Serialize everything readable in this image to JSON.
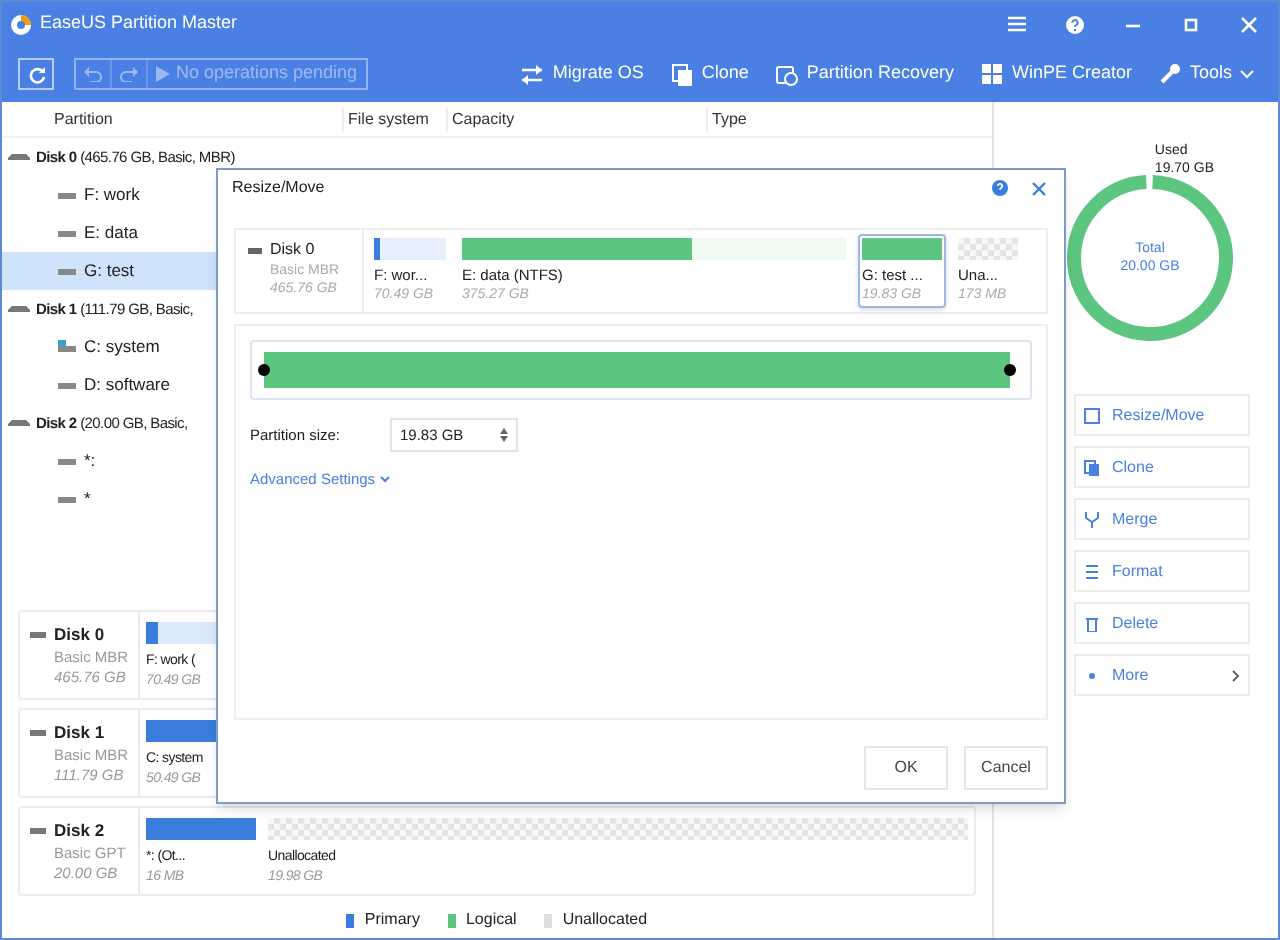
{
  "window": {
    "title": "EaseUS Partition Master"
  },
  "toolbar": {
    "undo_disabled": true,
    "redo_disabled": true,
    "status": "No operations pending",
    "status_disabled": true
  },
  "tools": [
    {
      "kind": "migrate",
      "label": "Migrate OS"
    },
    {
      "kind": "clone",
      "label": "Clone"
    },
    {
      "kind": "recovery",
      "label": "Partition Recovery"
    },
    {
      "kind": "winpe",
      "label": "WinPE Creator"
    },
    {
      "kind": "tools",
      "label": "Tools"
    }
  ],
  "table": {
    "columns": [
      "Partition",
      "File system",
      "Capacity",
      "Type"
    ],
    "disks": [
      {
        "name": "Disk 0",
        "detail": "(465.76 GB, Basic, MBR)",
        "children": [
          {
            "kind": "drive",
            "name": "F: work",
            "selected": false
          },
          {
            "kind": "drive",
            "name": "E: data",
            "selected": false
          },
          {
            "kind": "drive",
            "name": "G: test",
            "selected": true
          }
        ]
      },
      {
        "name": "Disk 1",
        "detail": "(111.79 GB, Basic,",
        "children": [
          {
            "kind": "system",
            "name": "C: system",
            "selected": false
          },
          {
            "kind": "drive",
            "name": "D: software",
            "selected": false
          }
        ]
      },
      {
        "name": "Disk 2",
        "detail": "(20.00 GB, Basic,",
        "children": [
          {
            "kind": "drive",
            "name": "*:",
            "selected": false
          },
          {
            "kind": "drive",
            "name": "*",
            "selected": false
          }
        ]
      }
    ]
  },
  "disk_map": [
    {
      "name": "Disk 0",
      "type": "Basic MBR",
      "size": "465.76 GB",
      "partitions": [
        {
          "kind": "primary",
          "label": "F: work (",
          "size": "70.49 GB",
          "level": 0.1
        }
      ]
    },
    {
      "name": "Disk 1",
      "type": "Basic MBR",
      "size": "111.79 GB",
      "partitions": [
        {
          "kind": "primary",
          "label": "C: system",
          "size": "50.49 GB",
          "level": 1
        }
      ]
    },
    {
      "name": "Disk 2",
      "type": "Basic GPT",
      "size": "20.00 GB",
      "partitions": [
        {
          "kind": "primary",
          "label": "*: (Ot...",
          "size": "16 MB",
          "level": 1
        },
        {
          "kind": "unallocated",
          "label": "Unallocated",
          "size": "19.98 GB"
        }
      ]
    }
  ],
  "legend": [
    {
      "label": "Primary",
      "color": "#3b7ddd"
    },
    {
      "label": "Logical",
      "color": "#5cc57f"
    },
    {
      "label": "Unallocated",
      "color": "#dddddd"
    }
  ],
  "usage": {
    "used_label": "Used",
    "used": "19.70 GB",
    "total_label": "Total",
    "total": "20.00 GB",
    "level": 0.985
  },
  "actions": [
    {
      "kind": "resize",
      "label": "Resize/Move"
    },
    {
      "kind": "clone",
      "label": "Clone"
    },
    {
      "kind": "merge",
      "label": "Merge"
    },
    {
      "kind": "format",
      "label": "Format"
    },
    {
      "kind": "delete",
      "label": "Delete"
    },
    {
      "kind": "more",
      "label": "More"
    }
  ],
  "dialog": {
    "title": "Resize/Move",
    "disk": {
      "name": "Disk 0",
      "type": "Basic MBR",
      "size": "465.76 GB"
    },
    "partitions": [
      {
        "kind": "primary",
        "label": "F: wor...",
        "size": "70.49 GB",
        "level": 0.08,
        "selected": false
      },
      {
        "kind": "logical",
        "label": "E: data (NTFS)",
        "size": "375.27 GB",
        "level": 0.6,
        "selected": false
      },
      {
        "kind": "logical",
        "label": "G: test ...",
        "size": "19.83 GB",
        "level": 1,
        "selected": true
      },
      {
        "kind": "unallocated",
        "label": "Una...",
        "size": "173 MB",
        "selected": false
      }
    ],
    "resize": {
      "level": 0.99
    },
    "size_label": "Partition size:",
    "size_value": "19.83 GB",
    "advanced": "Advanced Settings",
    "buttons": [
      "OK",
      "Cancel"
    ]
  }
}
